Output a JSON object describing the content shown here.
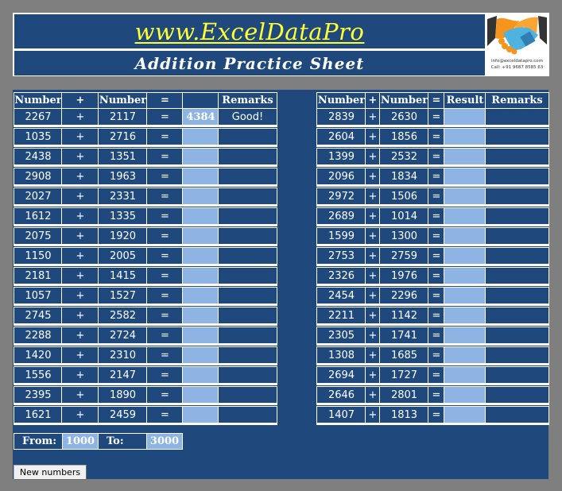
{
  "header": {
    "title": "www.ExcelDataPro",
    "subtitle": "Addition Practice Sheet",
    "logo": {
      "icon": "handshake-icon",
      "email": "info@exceldatapro.com",
      "phone": "Call: +91 9687 8585 63"
    }
  },
  "left_table": {
    "headers": [
      "Number",
      "+",
      "Number",
      "=",
      "",
      "Remarks"
    ],
    "rows": [
      {
        "a": "2267",
        "op": "+",
        "b": "2117",
        "eq": "=",
        "result": "4384",
        "remarks": "Good!"
      },
      {
        "a": "1035",
        "op": "+",
        "b": "2716",
        "eq": "=",
        "result": "",
        "remarks": ""
      },
      {
        "a": "2438",
        "op": "+",
        "b": "1351",
        "eq": "=",
        "result": "",
        "remarks": ""
      },
      {
        "a": "2908",
        "op": "+",
        "b": "1963",
        "eq": "=",
        "result": "",
        "remarks": ""
      },
      {
        "a": "2027",
        "op": "+",
        "b": "2331",
        "eq": "=",
        "result": "",
        "remarks": ""
      },
      {
        "a": "1612",
        "op": "+",
        "b": "1335",
        "eq": "=",
        "result": "",
        "remarks": ""
      },
      {
        "a": "2075",
        "op": "+",
        "b": "1920",
        "eq": "=",
        "result": "",
        "remarks": ""
      },
      {
        "a": "1150",
        "op": "+",
        "b": "2005",
        "eq": "=",
        "result": "",
        "remarks": ""
      },
      {
        "a": "2181",
        "op": "+",
        "b": "1415",
        "eq": "=",
        "result": "",
        "remarks": ""
      },
      {
        "a": "1057",
        "op": "+",
        "b": "1527",
        "eq": "=",
        "result": "",
        "remarks": ""
      },
      {
        "a": "2745",
        "op": "+",
        "b": "2582",
        "eq": "=",
        "result": "",
        "remarks": ""
      },
      {
        "a": "2288",
        "op": "+",
        "b": "2724",
        "eq": "=",
        "result": "",
        "remarks": ""
      },
      {
        "a": "1420",
        "op": "+",
        "b": "2310",
        "eq": "=",
        "result": "",
        "remarks": ""
      },
      {
        "a": "1556",
        "op": "+",
        "b": "2147",
        "eq": "=",
        "result": "",
        "remarks": ""
      },
      {
        "a": "2395",
        "op": "+",
        "b": "1890",
        "eq": "=",
        "result": "",
        "remarks": ""
      },
      {
        "a": "1621",
        "op": "+",
        "b": "2459",
        "eq": "=",
        "result": "",
        "remarks": ""
      }
    ]
  },
  "right_table": {
    "headers": [
      "Number",
      "+",
      "Number",
      "=",
      "Result",
      "Remarks"
    ],
    "rows": [
      {
        "a": "2839",
        "op": "+",
        "b": "2630",
        "eq": "=",
        "result": "",
        "remarks": ""
      },
      {
        "a": "2604",
        "op": "+",
        "b": "1856",
        "eq": "=",
        "result": "",
        "remarks": ""
      },
      {
        "a": "1399",
        "op": "+",
        "b": "2532",
        "eq": "=",
        "result": "",
        "remarks": ""
      },
      {
        "a": "2096",
        "op": "+",
        "b": "1834",
        "eq": "=",
        "result": "",
        "remarks": ""
      },
      {
        "a": "2972",
        "op": "+",
        "b": "1506",
        "eq": "=",
        "result": "",
        "remarks": ""
      },
      {
        "a": "2689",
        "op": "+",
        "b": "1014",
        "eq": "=",
        "result": "",
        "remarks": ""
      },
      {
        "a": "1599",
        "op": "+",
        "b": "1300",
        "eq": "=",
        "result": "",
        "remarks": ""
      },
      {
        "a": "2753",
        "op": "+",
        "b": "2759",
        "eq": "=",
        "result": "",
        "remarks": ""
      },
      {
        "a": "2326",
        "op": "+",
        "b": "1976",
        "eq": "=",
        "result": "",
        "remarks": ""
      },
      {
        "a": "2454",
        "op": "+",
        "b": "2296",
        "eq": "=",
        "result": "",
        "remarks": ""
      },
      {
        "a": "2211",
        "op": "+",
        "b": "1142",
        "eq": "=",
        "result": "",
        "remarks": ""
      },
      {
        "a": "2305",
        "op": "+",
        "b": "1741",
        "eq": "=",
        "result": "",
        "remarks": ""
      },
      {
        "a": "1308",
        "op": "+",
        "b": "1685",
        "eq": "=",
        "result": "",
        "remarks": ""
      },
      {
        "a": "2694",
        "op": "+",
        "b": "1727",
        "eq": "=",
        "result": "",
        "remarks": ""
      },
      {
        "a": "2646",
        "op": "+",
        "b": "2801",
        "eq": "=",
        "result": "",
        "remarks": ""
      },
      {
        "a": "1407",
        "op": "+",
        "b": "1813",
        "eq": "=",
        "result": "",
        "remarks": ""
      }
    ]
  },
  "range": {
    "from_label": "From:",
    "from_value": "1000",
    "to_label": "To:",
    "to_value": "3000"
  },
  "buttons": {
    "new_numbers": "New numbers"
  },
  "colors": {
    "background": "#7f7f7f",
    "sheet_blue": "#1f497d",
    "answer_cell": "#8db4e2",
    "title_yellow": "#ffff33"
  }
}
